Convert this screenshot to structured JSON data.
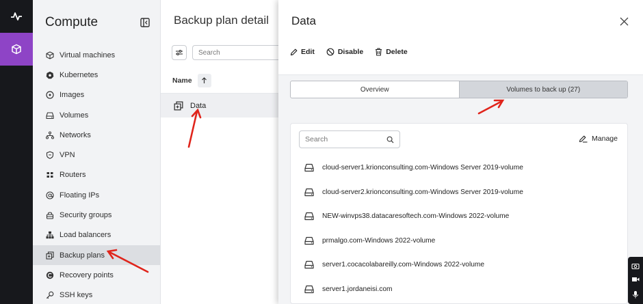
{
  "sidebar": {
    "title": "Compute",
    "items": [
      {
        "label": "Virtual machines",
        "icon": "cube-icon"
      },
      {
        "label": "Kubernetes",
        "icon": "kubernetes-icon"
      },
      {
        "label": "Images",
        "icon": "disc-icon"
      },
      {
        "label": "Volumes",
        "icon": "drive-icon"
      },
      {
        "label": "Networks",
        "icon": "network-icon"
      },
      {
        "label": "VPN",
        "icon": "shield-icon"
      },
      {
        "label": "Routers",
        "icon": "router-icon"
      },
      {
        "label": "Floating IPs",
        "icon": "at-icon"
      },
      {
        "label": "Security groups",
        "icon": "lock-icon"
      },
      {
        "label": "Load balancers",
        "icon": "hierarchy-icon"
      },
      {
        "label": "Backup plans",
        "icon": "backup-icon"
      },
      {
        "label": "Recovery points",
        "icon": "recovery-icon"
      },
      {
        "label": "SSH keys",
        "icon": "key-icon"
      }
    ],
    "active_index": 10
  },
  "content": {
    "title": "Backup plan detail",
    "search_placeholder": "Search",
    "column_name": "Name",
    "row_label": "Data"
  },
  "drawer": {
    "title": "Data",
    "actions": {
      "edit": "Edit",
      "disable": "Disable",
      "delete": "Delete"
    },
    "tabs": {
      "overview": "Overview",
      "volumes": "Volumes to back up (27)"
    },
    "search_placeholder": "Search",
    "manage_label": "Manage",
    "volumes": [
      "cloud-server1.krionconsulting.com-Windows Server 2019-volume",
      "cloud-server2.krionconsulting.com-Windows Server 2019-volume",
      "NEW-winvps38.datacaresoftech.com-Windows 2022-volume",
      "prmalgo.com-Windows 2022-volume",
      "server1.cocacolabareilly.com-Windows 2022-volume",
      "server1.jordaneisi.com"
    ]
  },
  "colors": {
    "rail_bg": "#17181c",
    "rail_active": "#8e44c6",
    "sidebar_bg": "#f2f3f5",
    "annotation_arrow": "#e0241b"
  }
}
